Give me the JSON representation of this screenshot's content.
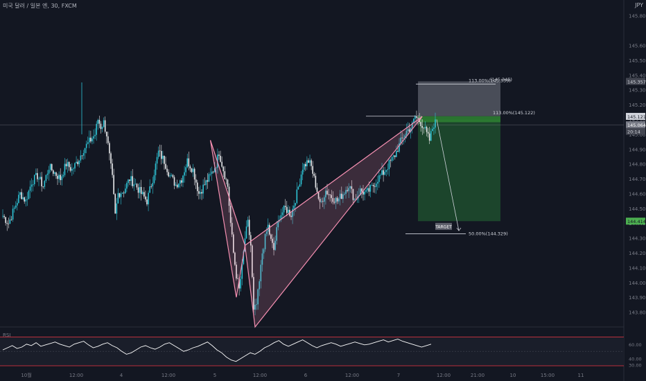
{
  "header": {
    "symbol_line": "미국 달러 / 일본 엔, 30, FXCM",
    "currency": "JPY"
  },
  "colors": {
    "background": "#131722",
    "up": "#2ec4d6",
    "down": "#e9eaec",
    "pattern": "#f48fb1",
    "stop_zone": "#50535e",
    "target_zone": "#1f4e2e",
    "axis_text": "#787b86",
    "rsi_line": "#ffffff",
    "rsi_band": "#f23645"
  },
  "chart_data": {
    "type": "candlestick",
    "title": "미국 달러 / 일본 엔, 30, FXCM",
    "ylabel": "JPY",
    "ylim": [
      143.7,
      145.85
    ],
    "y_ticks": [
      "145.800",
      "145.600",
      "145.500",
      "145.400",
      "145.300",
      "145.200",
      "145.100",
      "145.000",
      "144.900",
      "144.800",
      "144.700",
      "144.600",
      "144.500",
      "144.400",
      "144.300",
      "144.200",
      "144.100",
      "144.000",
      "143.900",
      "143.800"
    ],
    "x_ticks": [
      "10월",
      "12:00",
      "4",
      "12:00",
      "5",
      "12:00",
      "6",
      "12:00",
      "7",
      "12:00",
      "21:00",
      "10",
      "15:00",
      "11"
    ],
    "price_badges": [
      {
        "label": "145.357",
        "value": 145.357
      },
      {
        "label": "145.121",
        "value": 145.121
      },
      {
        "label": "145.064",
        "value": 145.064
      },
      {
        "label": "20:14",
        "value": 145.02
      },
      {
        "label": "144.414",
        "value": 144.414
      }
    ],
    "close_points": [
      [
        0,
        144.45
      ],
      [
        4,
        144.4
      ],
      [
        8,
        144.5
      ],
      [
        12,
        144.6
      ],
      [
        16,
        144.55
      ],
      [
        20,
        144.68
      ],
      [
        24,
        144.72
      ],
      [
        28,
        144.65
      ],
      [
        32,
        144.78
      ],
      [
        36,
        144.74
      ],
      [
        40,
        144.7
      ],
      [
        44,
        144.8
      ],
      [
        48,
        144.76
      ],
      [
        52,
        144.82
      ],
      [
        56,
        144.9
      ],
      [
        60,
        144.95
      ],
      [
        64,
        145.0
      ],
      [
        66,
        145.1
      ],
      [
        68,
        145.05
      ],
      [
        70,
        145.08
      ],
      [
        72,
        145.0
      ],
      [
        76,
        144.7
      ],
      [
        78,
        144.45
      ],
      [
        80,
        144.6
      ],
      [
        84,
        144.62
      ],
      [
        88,
        144.7
      ],
      [
        92,
        144.66
      ],
      [
        96,
        144.6
      ],
      [
        100,
        144.55
      ],
      [
        104,
        144.7
      ],
      [
        108,
        144.88
      ],
      [
        112,
        144.82
      ],
      [
        116,
        144.72
      ],
      [
        120,
        144.66
      ],
      [
        124,
        144.7
      ],
      [
        128,
        144.82
      ],
      [
        132,
        144.76
      ],
      [
        136,
        144.6
      ],
      [
        140,
        144.66
      ],
      [
        144,
        144.72
      ],
      [
        148,
        144.8
      ],
      [
        150,
        144.88
      ],
      [
        152,
        144.8
      ],
      [
        156,
        144.65
      ],
      [
        158,
        144.4
      ],
      [
        160,
        144.2
      ],
      [
        162,
        144.05
      ],
      [
        164,
        143.95
      ],
      [
        166,
        144.1
      ],
      [
        168,
        144.3
      ],
      [
        170,
        144.4
      ],
      [
        172,
        144.25
      ],
      [
        174,
        143.8
      ],
      [
        176,
        143.85
      ],
      [
        178,
        144.0
      ],
      [
        180,
        144.2
      ],
      [
        182,
        144.3
      ],
      [
        184,
        144.38
      ],
      [
        186,
        144.28
      ],
      [
        188,
        144.22
      ],
      [
        190,
        144.35
      ],
      [
        192,
        144.45
      ],
      [
        196,
        144.5
      ],
      [
        200,
        144.46
      ],
      [
        204,
        144.6
      ],
      [
        208,
        144.78
      ],
      [
        212,
        144.82
      ],
      [
        214,
        144.78
      ],
      [
        216,
        144.7
      ],
      [
        218,
        144.62
      ],
      [
        220,
        144.52
      ],
      [
        224,
        144.62
      ],
      [
        228,
        144.58
      ],
      [
        232,
        144.55
      ],
      [
        236,
        144.6
      ],
      [
        240,
        144.66
      ],
      [
        244,
        144.56
      ],
      [
        248,
        144.62
      ],
      [
        252,
        144.6
      ],
      [
        256,
        144.64
      ],
      [
        260,
        144.7
      ],
      [
        264,
        144.74
      ],
      [
        268,
        144.8
      ],
      [
        272,
        144.86
      ],
      [
        276,
        144.95
      ],
      [
        280,
        145.02
      ],
      [
        284,
        145.06
      ],
      [
        286,
        145.12
      ],
      [
        288,
        145.1
      ],
      [
        290,
        145.08
      ],
      [
        292,
        145.05
      ],
      [
        294,
        145.0
      ],
      [
        296,
        144.96
      ],
      [
        298,
        145.04
      ],
      [
        300,
        145.1
      ]
    ],
    "harmonic_pattern": {
      "points": [
        {
          "x": 144,
          "price": 144.96
        },
        {
          "x": 162,
          "price": 143.9
        },
        {
          "x": 168,
          "price": 144.25
        },
        {
          "x": 175,
          "price": 143.7
        },
        {
          "x": 291,
          "price": 145.12
        }
      ]
    },
    "levels": [
      {
        "label": "113.00%(145.122)",
        "price": 145.122
      },
      {
        "label": "113.00%(145.339)",
        "price": 145.339
      },
      {
        "label": "(145.345)",
        "price": 145.345
      },
      {
        "label": "50.00%(144.329)",
        "price": 144.329
      }
    ],
    "stop_zone": {
      "from": 145.122,
      "to": 145.357
    },
    "target_zone": {
      "from": 144.414,
      "to": 145.1
    },
    "target_label": "TARGET",
    "projection": {
      "from": 145.1,
      "to": 144.35
    },
    "rsi": {
      "label": "RSI",
      "ylim": [
        30,
        80
      ],
      "upper_band": 70,
      "lower_band": 30,
      "mid": 50,
      "ticks": [
        "60.00",
        "40.00",
        "30.00"
      ],
      "values": [
        52,
        55,
        58,
        54,
        56,
        60,
        58,
        62,
        57,
        59,
        61,
        63,
        60,
        58,
        56,
        60,
        62,
        64,
        59,
        55,
        57,
        60,
        62,
        58,
        55,
        50,
        46,
        48,
        52,
        56,
        58,
        55,
        53,
        56,
        60,
        62,
        58,
        54,
        50,
        52,
        55,
        57,
        60,
        63,
        58,
        52,
        48,
        42,
        38,
        36,
        40,
        44,
        48,
        46,
        50,
        55,
        58,
        62,
        65,
        60,
        57,
        60,
        63,
        66,
        62,
        58,
        55,
        58,
        60,
        62,
        60,
        57,
        59,
        61,
        63,
        61,
        59,
        60,
        62,
        64,
        66,
        63,
        65,
        67,
        64,
        62,
        60,
        58,
        56,
        58,
        60
      ]
    }
  }
}
